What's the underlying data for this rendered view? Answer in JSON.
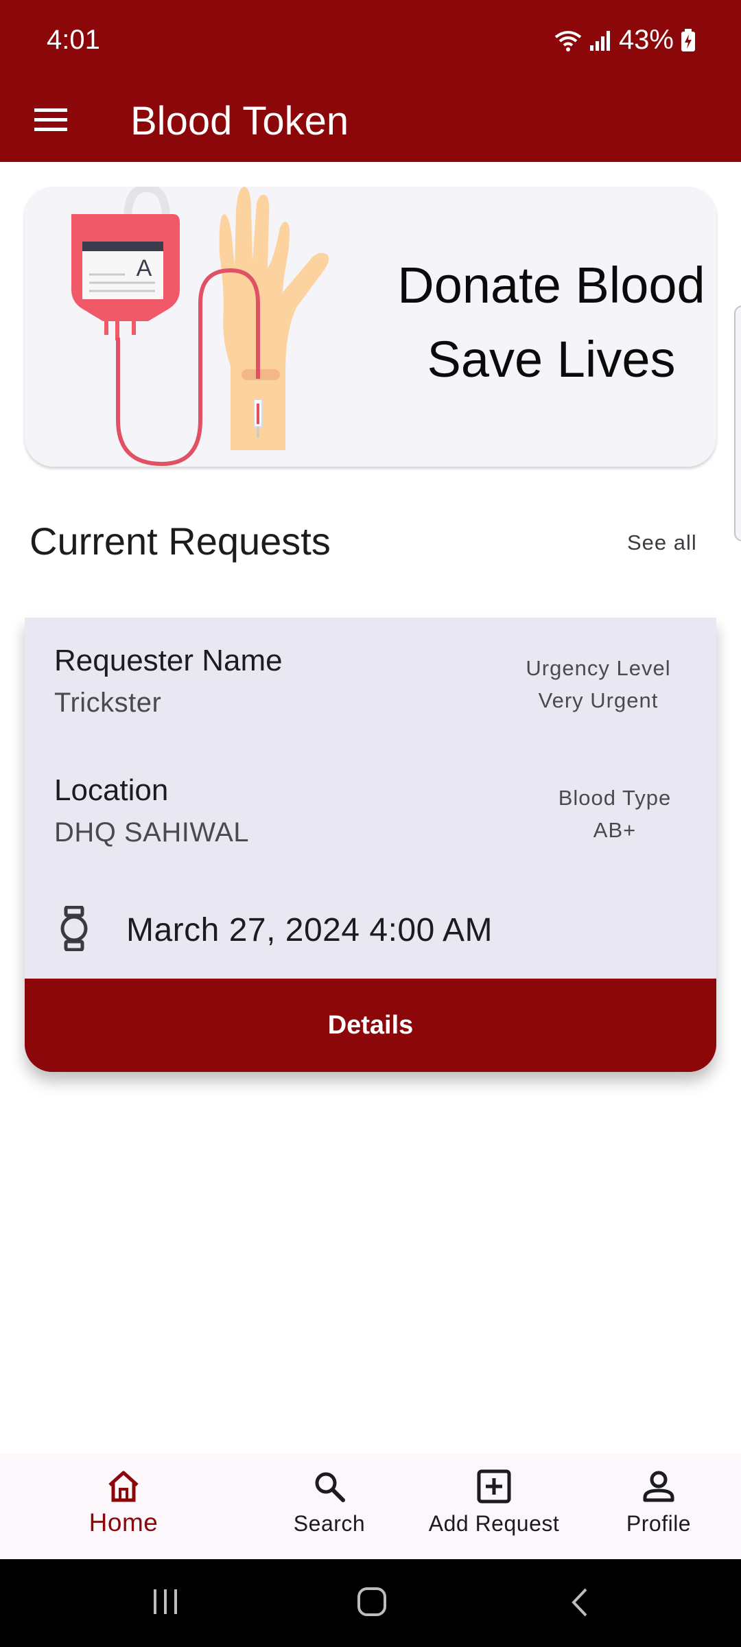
{
  "status_bar": {
    "time": "4:01",
    "battery": "43%"
  },
  "app_bar": {
    "title": "Blood Token"
  },
  "banner": {
    "line1": "Donate Blood",
    "line2": "Save Lives",
    "bag_label": "A"
  },
  "section": {
    "title": "Current Requests",
    "see_all": "See all"
  },
  "request_card": {
    "requester_label": "Requester Name",
    "requester_value": "Trickster",
    "urgency_label": "Urgency Level",
    "urgency_value": "Very Urgent",
    "location_label": "Location",
    "location_value": "DHQ SAHIWAL",
    "blood_type_label": "Blood Type",
    "blood_type_value": "AB+",
    "datetime": "March 27, 2024 4:00 AM",
    "details_button": "Details"
  },
  "bottom_nav": {
    "items": [
      {
        "label": "Home",
        "icon": "home-icon",
        "active": true
      },
      {
        "label": "Search",
        "icon": "search-icon",
        "active": false
      },
      {
        "label": "Add Request",
        "icon": "add-box-icon",
        "active": false
      },
      {
        "label": "Profile",
        "icon": "person-icon",
        "active": false
      }
    ]
  },
  "colors": {
    "primary": "#8b0709",
    "card": "#e9e7f1",
    "banner_bg": "#f4f4f9"
  }
}
